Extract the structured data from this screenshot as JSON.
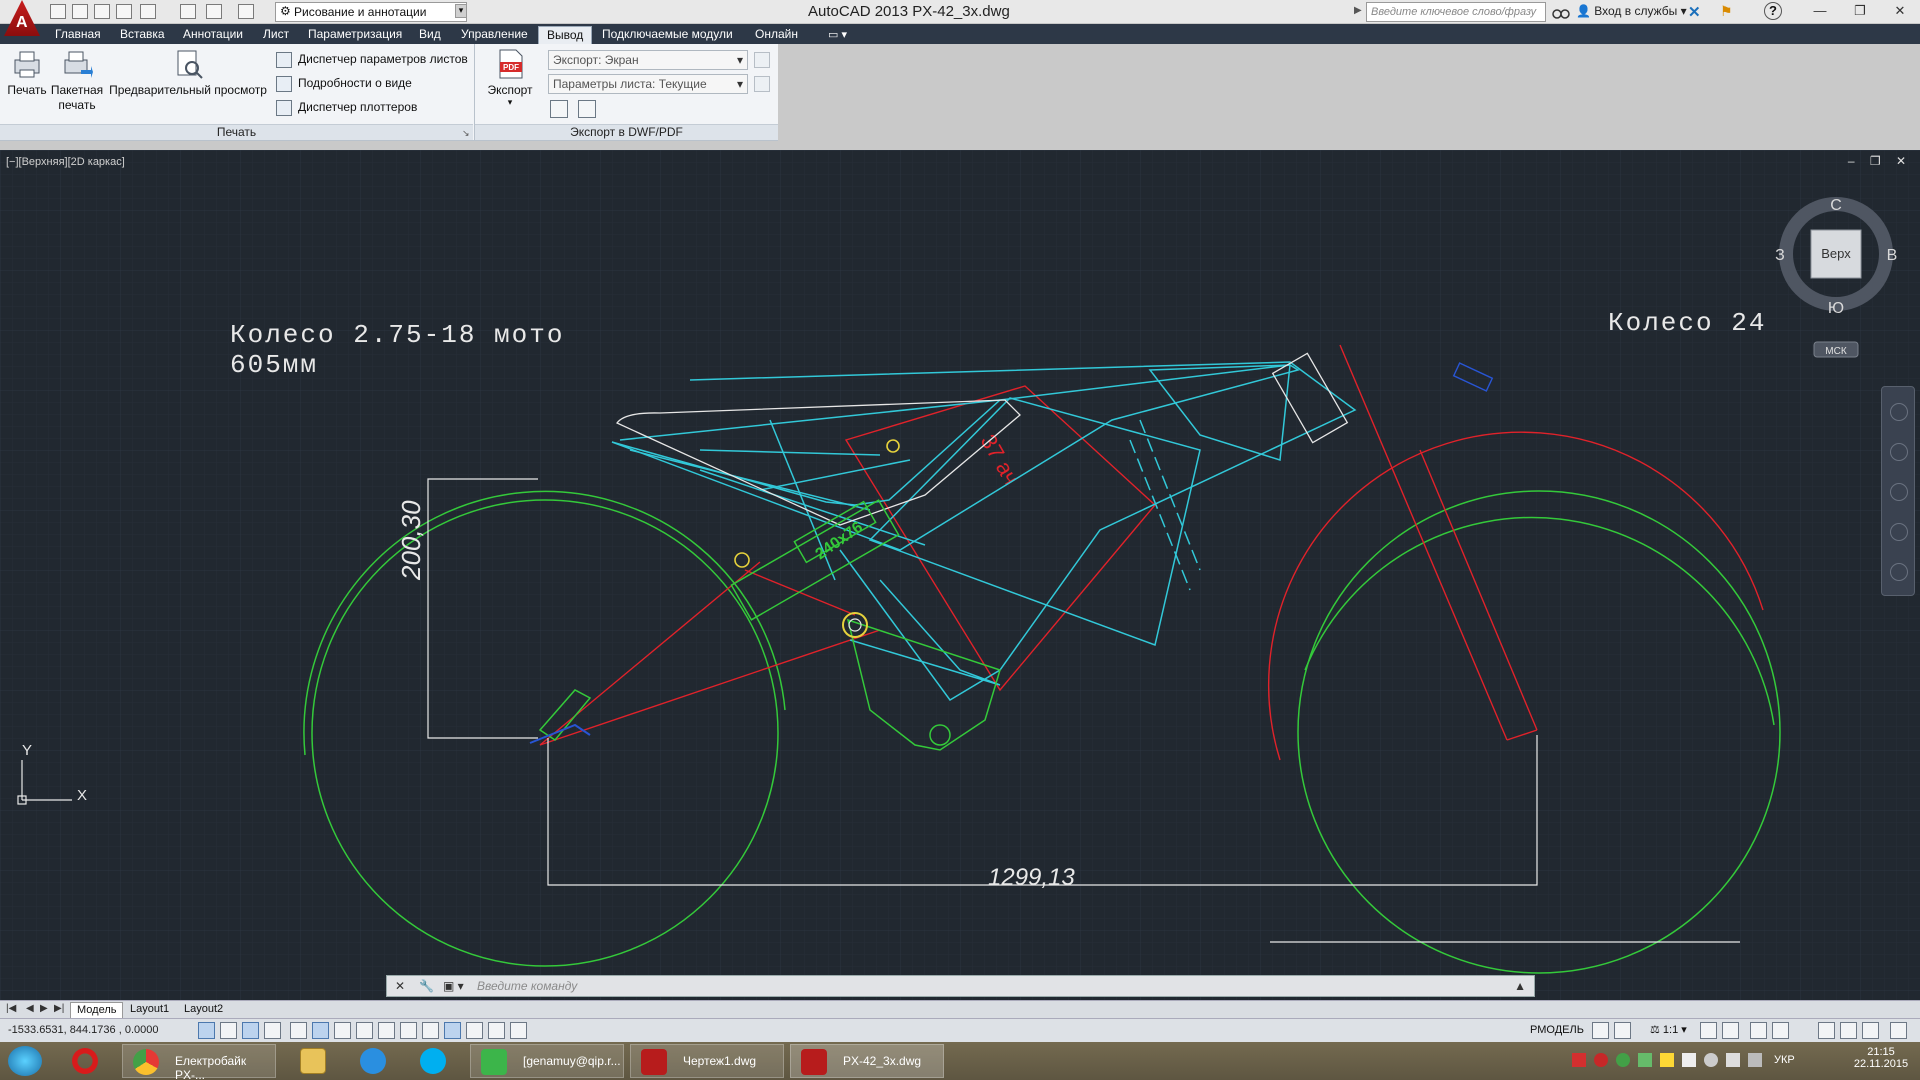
{
  "window": {
    "app_logo_letter": "A",
    "title": "AutoCAD 2013    PX-42_3x.dwg",
    "workspace": "Рисование и аннотации",
    "search_placeholder": "Введите ключевое слово/фразу",
    "signin": "Вход в службы",
    "controls": [
      "—",
      "❐",
      "✕"
    ]
  },
  "menu": {
    "tabs": [
      "Главная",
      "Вставка",
      "Аннотации",
      "Лист",
      "Параметризация",
      "Вид",
      "Управление",
      "Вывод",
      "Подключаемые модули",
      "Онлайн"
    ],
    "active": "Вывод"
  },
  "ribbon": {
    "print_panel": {
      "title": "Печать",
      "buttons": [
        "Печать",
        "Пакетная печать",
        "Предварительный просмотр"
      ],
      "small_buttons": [
        "Диспетчер параметров листов",
        "Подробности о виде",
        "Диспетчер плоттеров"
      ]
    },
    "export_panel": {
      "title": "Экспорт в DWF/PDF",
      "export_button": "Экспорт",
      "pdf_icon_label": "PDF",
      "export_combo": "Экспорт: Экран",
      "page_setup_combo": "Параметры листа: Текущие"
    }
  },
  "viewport": {
    "label": "[−][Верхняя][2D каркас]",
    "controls": "– ❐ ✕",
    "viewcube": {
      "top": "Верх",
      "north": "С",
      "south": "Ю",
      "west": "З",
      "east": "В",
      "ucs": "МСК"
    },
    "axis_y": "Y",
    "axis_x": "X"
  },
  "drawing_text": {
    "wheel_front": "Колесо 2.75-18 мото",
    "wheel_front_size": "605мм",
    "wheel_rear": "Колесо 24",
    "dim_height": "200,30",
    "dim_length": "1299,13",
    "battery_label": "37 ач",
    "motor_label": "240х76"
  },
  "colors": {
    "frame": "#32c8d8",
    "wheel": "#34c93a",
    "red_lines": "#e0222a",
    "dims": "#e8e8e8",
    "background": "#212830"
  },
  "command": {
    "placeholder": "Введите команду"
  },
  "layouts": {
    "tabs": [
      "Модель",
      "Layout1",
      "Layout2"
    ],
    "active": "Модель"
  },
  "status": {
    "coords": "-1533.6531, 844.1736 , 0.0000",
    "model": "РМОДЕЛЬ",
    "scale": "1:1"
  },
  "taskbar": {
    "apps": [
      {
        "label": "",
        "icon": "opera-icon"
      },
      {
        "label": "Електробайк PX-...",
        "icon": "chrome-icon"
      },
      {
        "label": "",
        "icon": "explorer-icon"
      },
      {
        "label": "",
        "icon": "ie-icon"
      },
      {
        "label": "",
        "icon": "skype-icon"
      },
      {
        "label": "[genamuy@qip.r...",
        "icon": "qip-icon"
      },
      {
        "label": "Чертеж1.dwg",
        "icon": "autocad-icon"
      },
      {
        "label": "PX-42_3x.dwg",
        "icon": "autocad-icon"
      }
    ],
    "lang": "УКР",
    "time": "21:15",
    "date": "22.11.2015"
  }
}
